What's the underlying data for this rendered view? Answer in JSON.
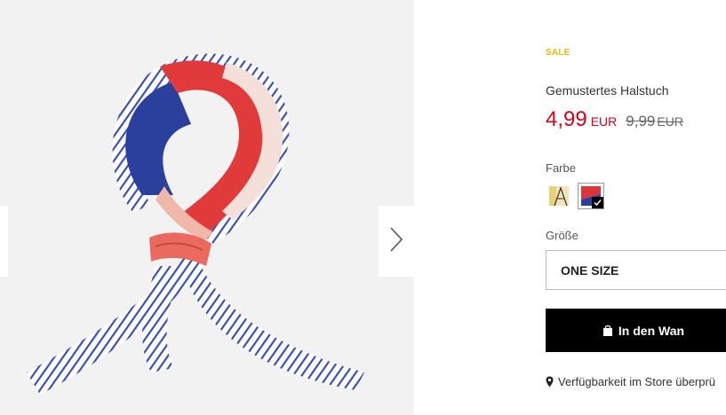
{
  "product": {
    "badge": "SALE",
    "title": "Gemustertes Halstuch",
    "price_current": "4,99",
    "currency_current": "EUR",
    "price_old": "9,99",
    "currency_old": "EUR"
  },
  "color": {
    "label": "Farbe",
    "options": [
      {
        "icon": "beige-pattern-swatch",
        "selected": false
      },
      {
        "icon": "blue-red-pattern-swatch",
        "selected": true
      }
    ]
  },
  "size": {
    "label": "Größe",
    "selected": "ONE SIZE"
  },
  "cart_button": {
    "label": "In den Wan"
  },
  "store_link": {
    "label": "Verfügbarkeit im Store überprü"
  },
  "colors": {
    "sale_badge": "#e8b912",
    "price": "#d0021b",
    "button_bg": "#000000",
    "scarf_blue": "#2b3f9c",
    "scarf_red": "#e03a3a",
    "scarf_pink": "#f0b8a8"
  },
  "gallery": {
    "icons": [
      "chevron-right-icon",
      "chevron-left-icon"
    ]
  }
}
